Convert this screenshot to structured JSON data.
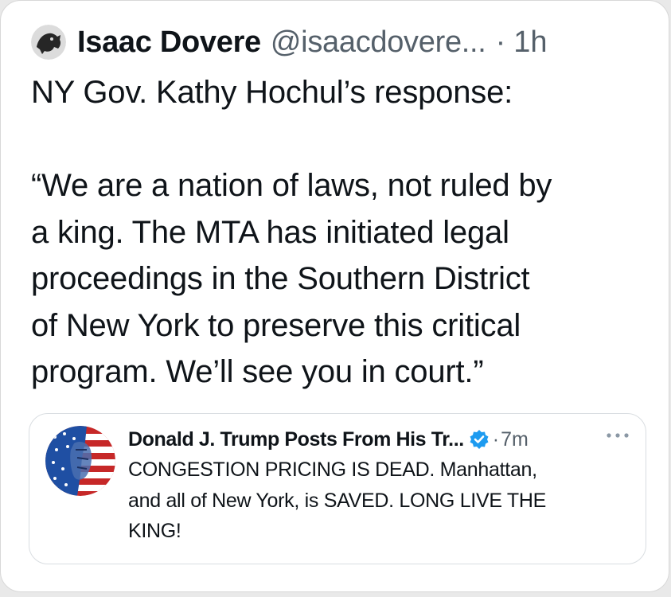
{
  "tweet": {
    "author_name": "Isaac Dovere",
    "handle": "@isaacdovere...",
    "separator": "·",
    "time": "1h",
    "avatar_icon": "author-avatar",
    "line1": "NY Gov. Kathy Hochul’s response:",
    "quote_text": "“We are a nation of laws, not ruled by\na king. The MTA has initiated legal\nproceedings in the Southern District\nof New York to preserve this critical\nprogram. We’ll see you in court.”"
  },
  "quoted_tweet": {
    "author_name": "Donald J. Trump Posts From His Tr...",
    "verified_icon": "verified-badge-icon",
    "separator": "·",
    "time": "7m",
    "more_icon": "more-options-icon",
    "text": "CONGESTION PRICING IS DEAD. Manhattan,\nand all of New York, is SAVED. LONG LIVE THE\nKING!"
  },
  "colors": {
    "text": "#0f1419",
    "secondary_text": "#55606a",
    "verified_blue": "#1d9bf0",
    "flag_red": "#c62828",
    "flag_blue": "#1f4fa3"
  }
}
